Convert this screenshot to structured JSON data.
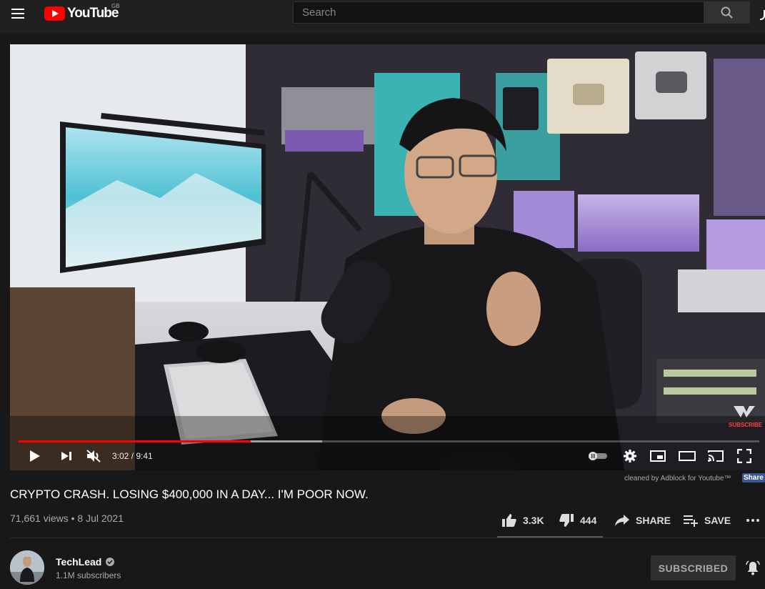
{
  "header": {
    "logo_text": "YouTube",
    "region": "GB",
    "search_placeholder": "Search"
  },
  "player": {
    "current_time": "3:02",
    "duration": "9:41",
    "time_display": "3:02 / 9:41",
    "progress_fraction": 0.313,
    "buffer_fraction": 0.41,
    "watermark_text": "SUBSCRIBE",
    "muted": true,
    "icons": [
      "play-icon",
      "next-icon",
      "mute-icon",
      "autoplay-toggle",
      "settings-icon",
      "miniplayer-icon",
      "theater-icon",
      "cast-icon",
      "fullscreen-icon"
    ]
  },
  "adblock": {
    "text": "cleaned by Adblock for Youtube™",
    "share_label": "Share"
  },
  "video": {
    "title": "CRYPTO CRASH. LOSING $400,000 IN A DAY... I'M POOR NOW.",
    "views_date": "71,661 views • 8 Jul 2021"
  },
  "actions": {
    "likes": "3.3K",
    "dislikes": "444",
    "share_label": "SHARE",
    "save_label": "SAVE"
  },
  "channel": {
    "name": "TechLead",
    "subscribers": "1.1M subscribers",
    "subscribe_label": "SUBSCRIBED"
  },
  "colors": {
    "progress": "#ff0000",
    "background": "#181818",
    "topbar": "#202020"
  }
}
